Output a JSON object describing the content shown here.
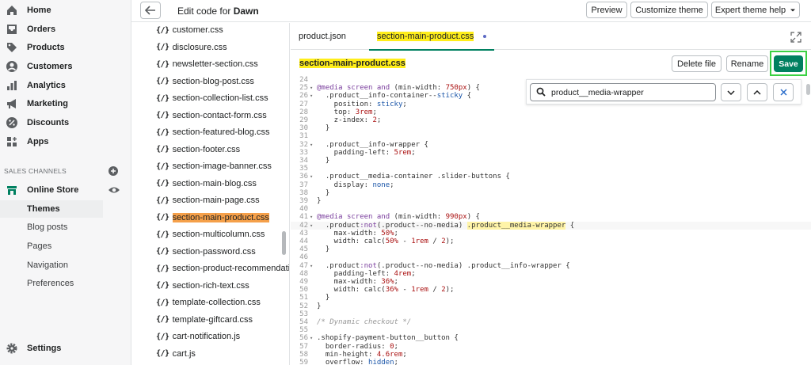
{
  "nav": {
    "items": [
      {
        "label": "Home",
        "icon": "home-icon"
      },
      {
        "label": "Orders",
        "icon": "orders-icon"
      },
      {
        "label": "Products",
        "icon": "tag-icon"
      },
      {
        "label": "Customers",
        "icon": "person-icon"
      },
      {
        "label": "Analytics",
        "icon": "bar-chart-icon"
      },
      {
        "label": "Marketing",
        "icon": "megaphone-icon"
      },
      {
        "label": "Discounts",
        "icon": "discount-icon"
      },
      {
        "label": "Apps",
        "icon": "apps-icon"
      }
    ],
    "sales_channels_title": "SALES CHANNELS",
    "online_store": "Online Store",
    "sub_items": [
      "Themes",
      "Blog posts",
      "Pages",
      "Navigation",
      "Preferences"
    ],
    "settings": "Settings"
  },
  "header": {
    "title_prefix": "Edit code for ",
    "theme_name": "Dawn",
    "preview": "Preview",
    "customize": "Customize theme",
    "expert_help": "Expert theme help"
  },
  "files": [
    "customer.css",
    "disclosure.css",
    "newsletter-section.css",
    "section-blog-post.css",
    "section-collection-list.css",
    "section-contact-form.css",
    "section-featured-blog.css",
    "section-footer.css",
    "section-image-banner.css",
    "section-main-blog.css",
    "section-main-page.css",
    "section-main-product.css",
    "section-multicolumn.css",
    "section-password.css",
    "section-product-recommendations.css",
    "section-rich-text.css",
    "template-collection.css",
    "template-giftcard.css",
    "cart-notification.js",
    "cart.js"
  ],
  "file_icon": "{/}",
  "tabs": {
    "tab1": "product.json",
    "tab2": "section-main-product.css"
  },
  "toolbar": {
    "filename": "section-main-product.css",
    "delete": "Delete file",
    "rename": "Rename",
    "save": "Save"
  },
  "search": {
    "query": "product__media-wrapper"
  },
  "code_lines": [
    {
      "n": "24",
      "t": ""
    },
    {
      "n": "25",
      "t": "@media screen and (min-width: 750px) {",
      "f": true
    },
    {
      "n": "26",
      "t": "  .product__info-container--sticky {",
      "f": true
    },
    {
      "n": "27",
      "t": "    position: sticky;"
    },
    {
      "n": "28",
      "t": "    top: 3rem;"
    },
    {
      "n": "29",
      "t": "    z-index: 2;"
    },
    {
      "n": "30",
      "t": "  }"
    },
    {
      "n": "31",
      "t": ""
    },
    {
      "n": "32",
      "t": "  .product__info-wrapper {",
      "f": true
    },
    {
      "n": "33",
      "t": "    padding-left: 5rem;"
    },
    {
      "n": "34",
      "t": "  }"
    },
    {
      "n": "35",
      "t": ""
    },
    {
      "n": "36",
      "t": "  .product__media-container .slider-buttons {",
      "f": true
    },
    {
      "n": "37",
      "t": "    display: none;"
    },
    {
      "n": "38",
      "t": "  }"
    },
    {
      "n": "39",
      "t": "}"
    },
    {
      "n": "40",
      "t": ""
    },
    {
      "n": "41",
      "t": "@media screen and (min-width: 990px) {",
      "f": true
    },
    {
      "n": "42",
      "t": "  .product:not(.product--no-media) .product__media-wrapper {",
      "f": true,
      "cur": true
    },
    {
      "n": "43",
      "t": "    max-width: 50%;"
    },
    {
      "n": "44",
      "t": "    width: calc(50% - 1rem / 2);"
    },
    {
      "n": "45",
      "t": "  }"
    },
    {
      "n": "46",
      "t": ""
    },
    {
      "n": "47",
      "t": "  .product:not(.product--no-media) .product__info-wrapper {",
      "f": true
    },
    {
      "n": "48",
      "t": "    padding-left: 4rem;"
    },
    {
      "n": "49",
      "t": "    max-width: 36%;"
    },
    {
      "n": "50",
      "t": "    width: calc(36% - 1rem / 2);"
    },
    {
      "n": "51",
      "t": "  }"
    },
    {
      "n": "52",
      "t": "}"
    },
    {
      "n": "53",
      "t": ""
    },
    {
      "n": "54",
      "t": "/* Dynamic checkout */"
    },
    {
      "n": "55",
      "t": ""
    },
    {
      "n": "56",
      "t": ".shopify-payment-button__button {",
      "f": true
    },
    {
      "n": "57",
      "t": "  border-radius: 0;"
    },
    {
      "n": "58",
      "t": "  min-height: 4.6rem;"
    },
    {
      "n": "59",
      "t": "  overflow: hidden;"
    },
    {
      "n": "60",
      "t": "}"
    }
  ],
  "colors": {
    "accent": "#008060",
    "highlight_file": "#f5a04a",
    "highlight_tab": "#ffee1a",
    "save_outline": "#3bd143"
  }
}
